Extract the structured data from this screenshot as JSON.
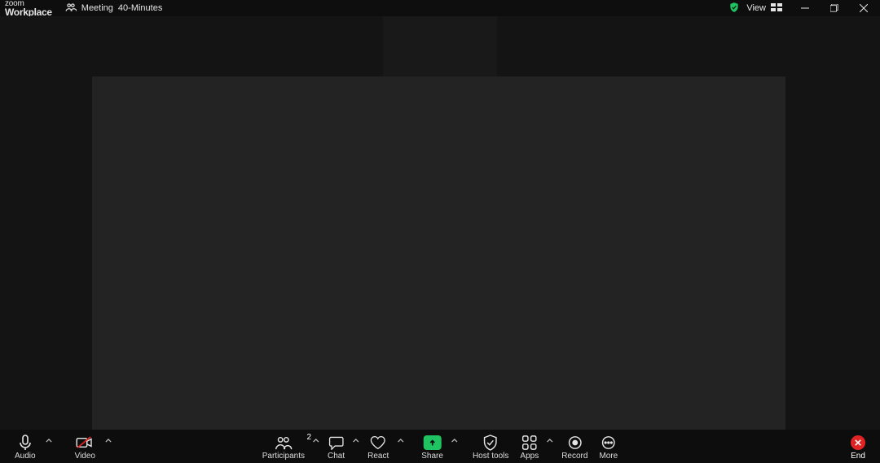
{
  "brand": {
    "line1": "zoom",
    "line2": "Workplace"
  },
  "header": {
    "meeting_label": "Meeting",
    "duration_label": "40-Minutes",
    "view_label": "View"
  },
  "toolbar": {
    "audio": "Audio",
    "video": "Video",
    "participants": "Participants",
    "participants_count": "2",
    "chat": "Chat",
    "react": "React",
    "share": "Share",
    "host_tools": "Host tools",
    "apps": "Apps",
    "record": "Record",
    "more": "More",
    "end": "End"
  }
}
